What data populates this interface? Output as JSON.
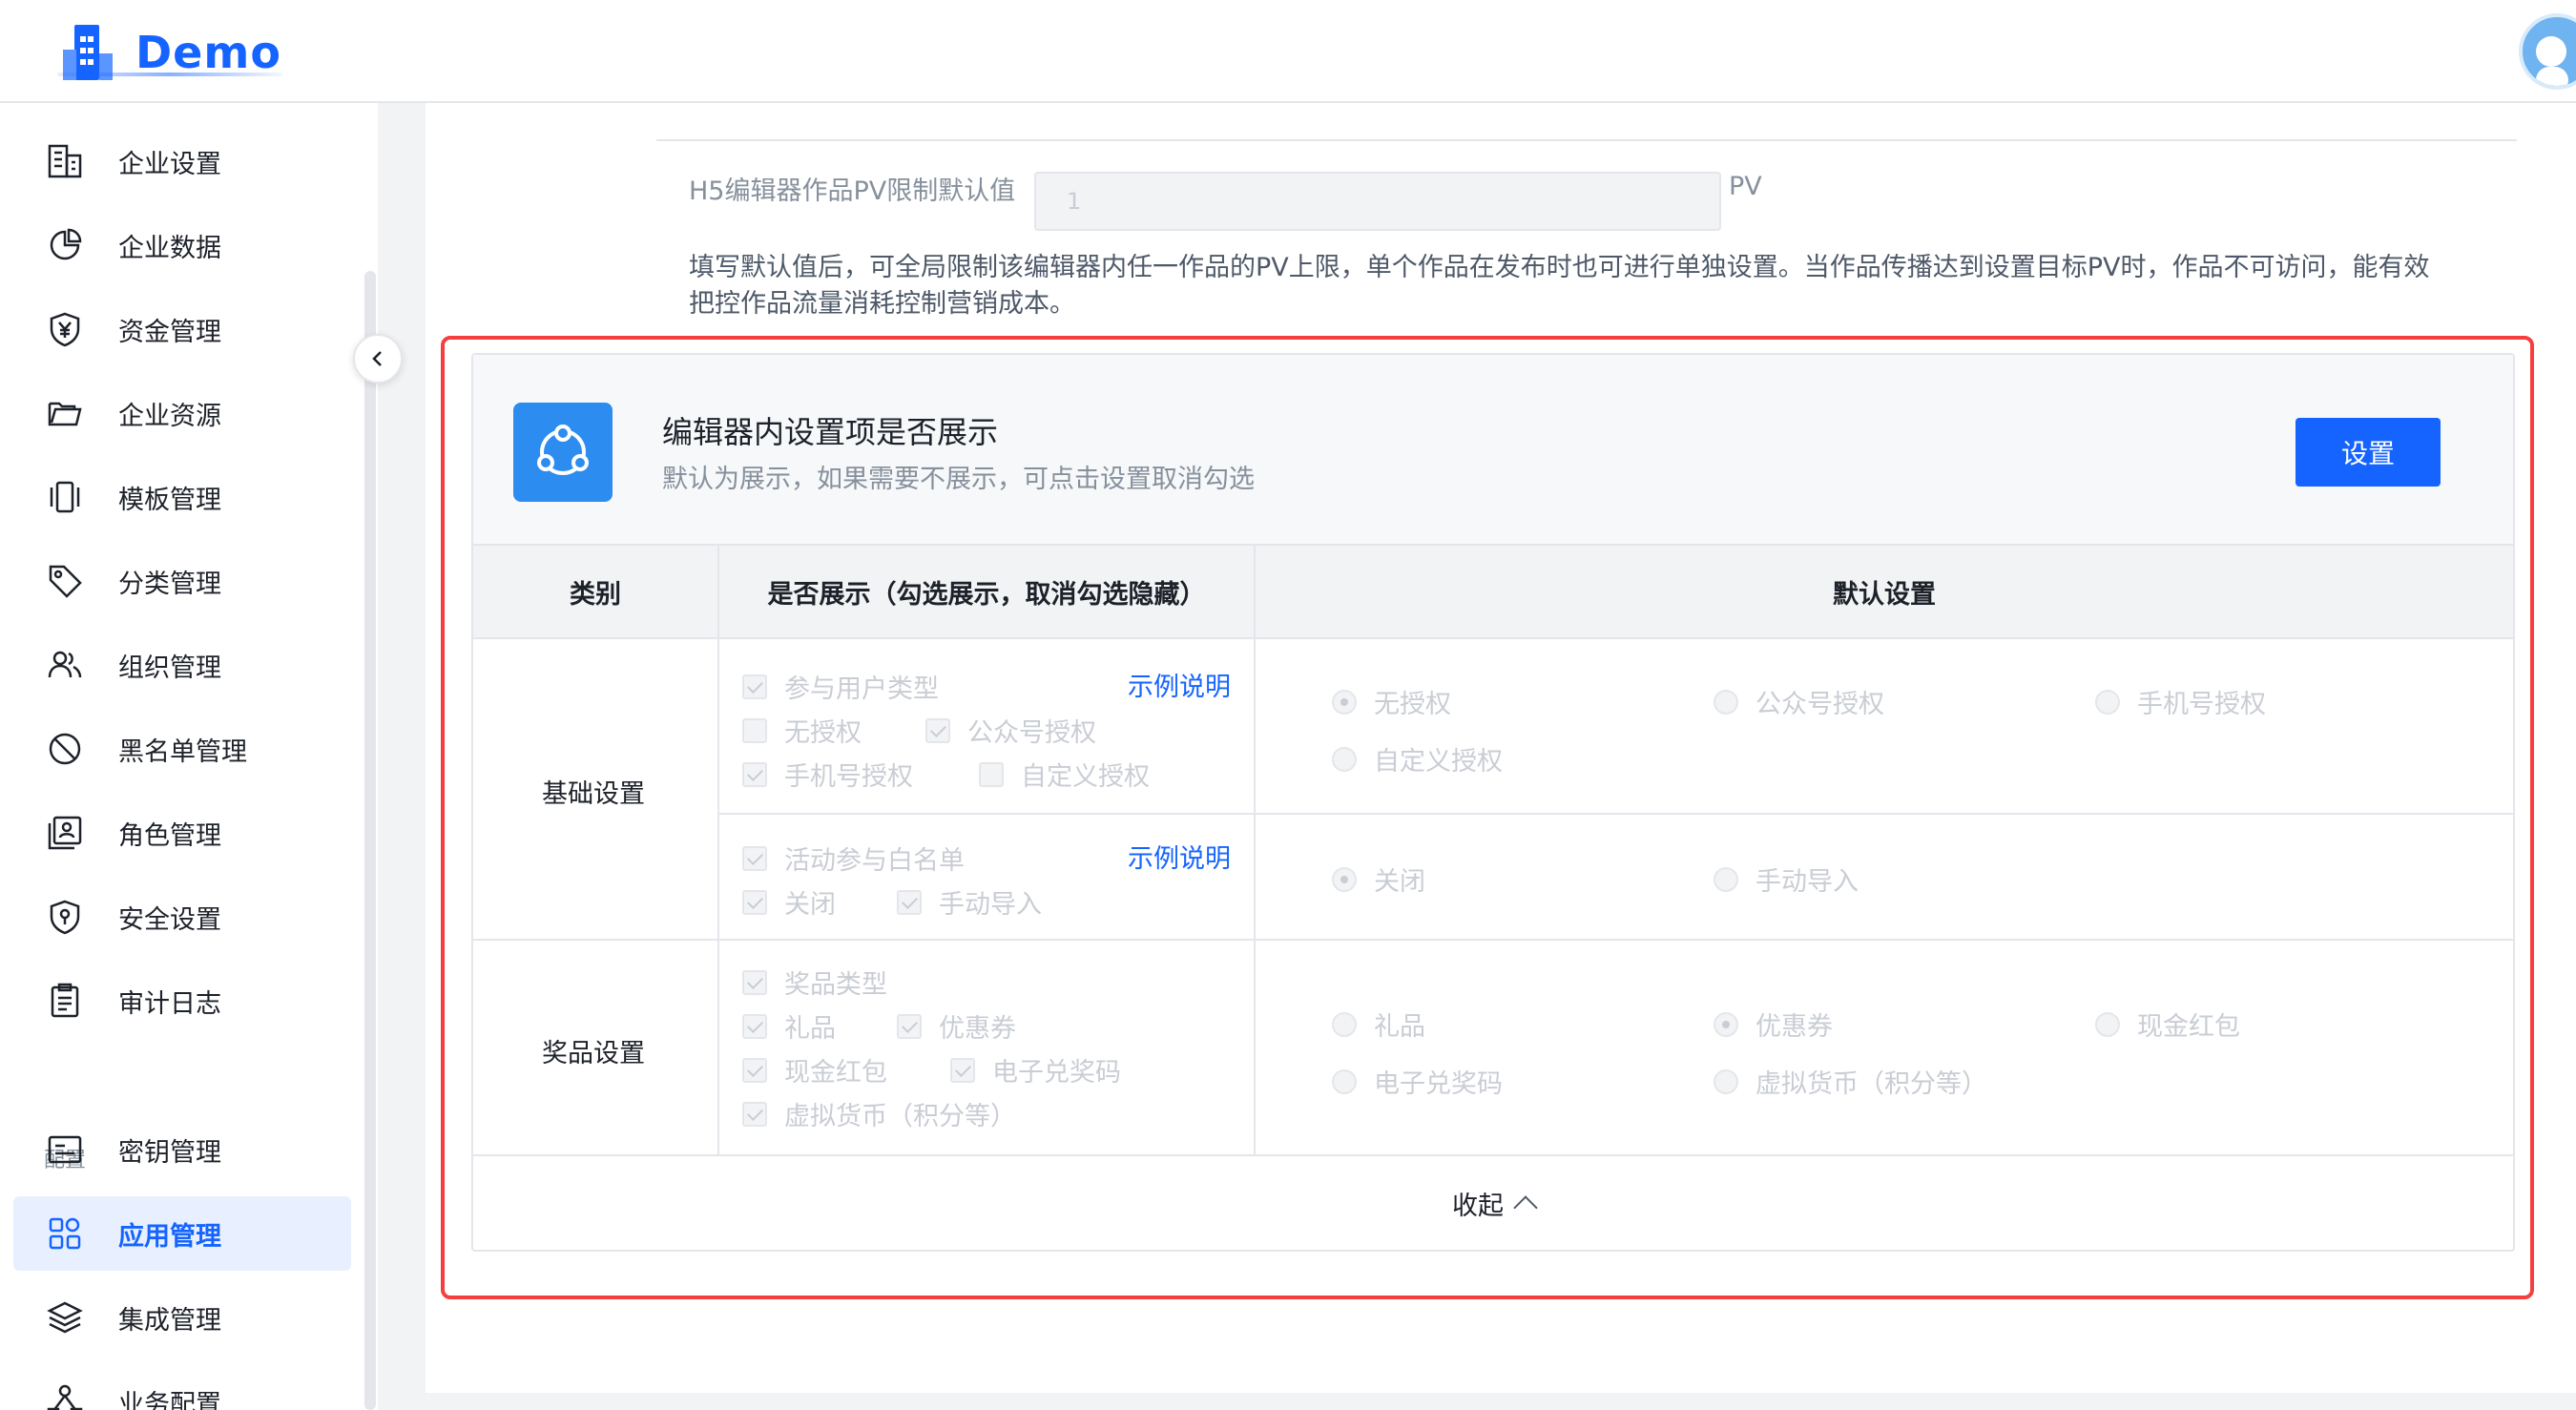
{
  "app": {
    "brand": "Demo"
  },
  "sidebar": {
    "items": [
      {
        "label": "企业设置",
        "icon": "building-icon"
      },
      {
        "label": "企业数据",
        "icon": "pie-chart-icon"
      },
      {
        "label": "资金管理",
        "icon": "yuan-shield-icon"
      },
      {
        "label": "企业资源",
        "icon": "folder-icon"
      },
      {
        "label": "模板管理",
        "icon": "template-icon"
      },
      {
        "label": "分类管理",
        "icon": "tag-icon"
      },
      {
        "label": "组织管理",
        "icon": "users-icon"
      },
      {
        "label": "黑名单管理",
        "icon": "ban-icon"
      },
      {
        "label": "角色管理",
        "icon": "role-icon"
      },
      {
        "label": "安全设置",
        "icon": "security-icon"
      },
      {
        "label": "审计日志",
        "icon": "clipboard-icon"
      }
    ],
    "section_label": "配置",
    "config_items": [
      {
        "label": "密钥管理",
        "icon": "key-card-icon"
      },
      {
        "label": "应用管理",
        "icon": "apps-icon",
        "active": true
      },
      {
        "label": "集成管理",
        "icon": "layers-icon"
      },
      {
        "label": "业务配置",
        "icon": "business-icon"
      }
    ]
  },
  "pv_limit": {
    "label": "H5编辑器作品PV限制默认值",
    "placeholder": "1",
    "unit": "PV",
    "help": "填写默认值后，可全局限制该编辑器内任一作品的PV上限，单个作品在发布时也可进行单独设置。当作品传播达到设置目标PV时，作品不可访问，能有效把控作品流量消耗控制营销成本。"
  },
  "panel": {
    "title": "编辑器内设置项是否展示",
    "subtitle": "默认为展示，如果需要不展示，可点击设置取消勾选",
    "set_button": "设置",
    "columns": [
      "类别",
      "是否展示（勾选展示，取消勾选隐藏）",
      "默认设置"
    ],
    "example_link": "示例说明",
    "basic": {
      "category": "基础设置",
      "group1": {
        "title": "参与用户类型",
        "options": [
          "无授权",
          "公众号授权",
          "手机号授权",
          "自定义授权"
        ],
        "defaults": [
          "无授权",
          "公众号授权",
          "手机号授权",
          "自定义授权"
        ],
        "selected_default": "无授权"
      },
      "group2": {
        "title": "活动参与白名单",
        "options": [
          "关闭",
          "手动导入"
        ],
        "defaults": [
          "关闭",
          "手动导入"
        ],
        "selected_default": "关闭"
      }
    },
    "prize": {
      "category": "奖品设置",
      "title": "奖品类型",
      "options": [
        "礼品",
        "优惠券",
        "现金红包",
        "电子兑奖码",
        "虚拟货币（积分等）"
      ],
      "defaults": [
        "礼品",
        "优惠券",
        "现金红包",
        "电子兑奖码",
        "虚拟货币（积分等）"
      ],
      "selected_default": "优惠券"
    },
    "collapse_label": "收起"
  }
}
